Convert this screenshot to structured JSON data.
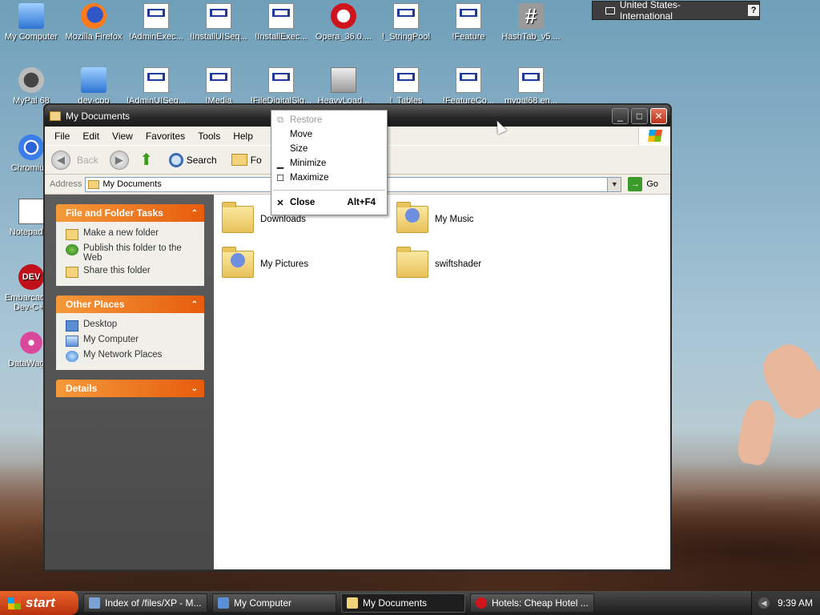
{
  "desktop": {
    "icons_row1": [
      "My Computer",
      "Mozilla Firefox",
      "!AdminExec...",
      "!InstallUISeq...",
      "!InstallExec...",
      "Opera_36.0....",
      "!_StringPool",
      "!Feature",
      "HashTab_v5...."
    ],
    "icons_row2": [
      "MyPal 68",
      "dev-cpp",
      "!AdminUISeq...",
      "!Media",
      "!FileDigitalSig...",
      "HeavyLoad...",
      "!_Tables",
      "!FeatureCo...",
      "mypal68.en..."
    ],
    "icons_left": [
      "Chromium",
      "Notepad++",
      "Embarcadero Dev-C++",
      "DataWagon"
    ],
    "dev_badge": "DEV"
  },
  "langbar": {
    "label": "United States-International",
    "help": "?"
  },
  "window": {
    "title": "My Documents",
    "menu": [
      "File",
      "Edit",
      "View",
      "Favorites",
      "Tools",
      "Help"
    ],
    "toolbar": {
      "back": "Back",
      "search": "Search",
      "folders": "Fo"
    },
    "address": {
      "label": "Address",
      "value": "My Documents",
      "go": "Go"
    },
    "sidebar": {
      "file_tasks": {
        "title": "File and Folder Tasks",
        "items": [
          "Make a new folder",
          "Publish this folder to the Web",
          "Share this folder"
        ]
      },
      "other_places": {
        "title": "Other Places",
        "items": [
          "Desktop",
          "My Computer",
          "My Network Places"
        ]
      },
      "details": {
        "title": "Details"
      }
    },
    "files": [
      "Downloads",
      "My Music",
      "My Pictures",
      "swiftshader"
    ]
  },
  "context_menu": {
    "items": [
      {
        "label": "Restore",
        "disabled": true
      },
      {
        "label": "Move"
      },
      {
        "label": "Size"
      },
      {
        "label": "Minimize"
      },
      {
        "label": "Maximize"
      },
      {
        "label": "Close",
        "shortcut": "Alt+F4"
      }
    ]
  },
  "taskbar": {
    "start": "start",
    "tasks": [
      "Index of /files/XP - M...",
      "My Computer",
      "My Documents",
      "Hotels: Cheap Hotel ..."
    ],
    "active_index": 2,
    "clock": "9:39 AM"
  }
}
